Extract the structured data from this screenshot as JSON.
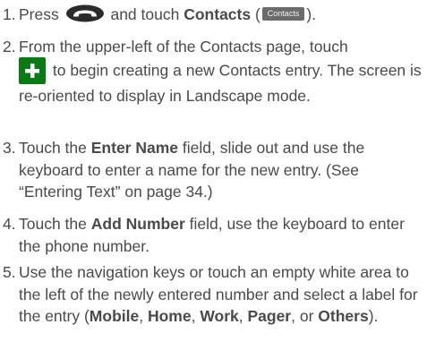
{
  "steps": [
    {
      "num": "1.",
      "t1": "Press ",
      "t2": " and touch ",
      "b1": "Contacts",
      "t3": " (",
      "chip": "Contacts",
      "t4": ")."
    },
    {
      "num": "2.",
      "t1": "From the upper-left of the Contacts page, touch",
      "t2": " to begin creating a new Contacts entry. The screen is re-oriented to display in Landscape mode."
    },
    {
      "num": "3.",
      "t1": "Touch the ",
      "b1": "Enter Name",
      "t2": " field, slide out and use the keyboard to enter a name for the new entry. (See “Entering Text” on page 34.)"
    },
    {
      "num": "4.",
      "t1": "Touch the ",
      "b1": "Add Number",
      "t2": " field, use the keyboard to enter the phone number."
    },
    {
      "num": "5.",
      "t1": "Use the navigation keys or touch an empty white area to the left of the newly entered number and select a label for the entry (",
      "b1": "Mobile",
      "t2": ", ",
      "b2": "Home",
      "t3": ", ",
      "b3": "Work",
      "t4": ", ",
      "b4": "Pager",
      "t5": ", or ",
      "b5": "Others",
      "t6": ")."
    }
  ]
}
